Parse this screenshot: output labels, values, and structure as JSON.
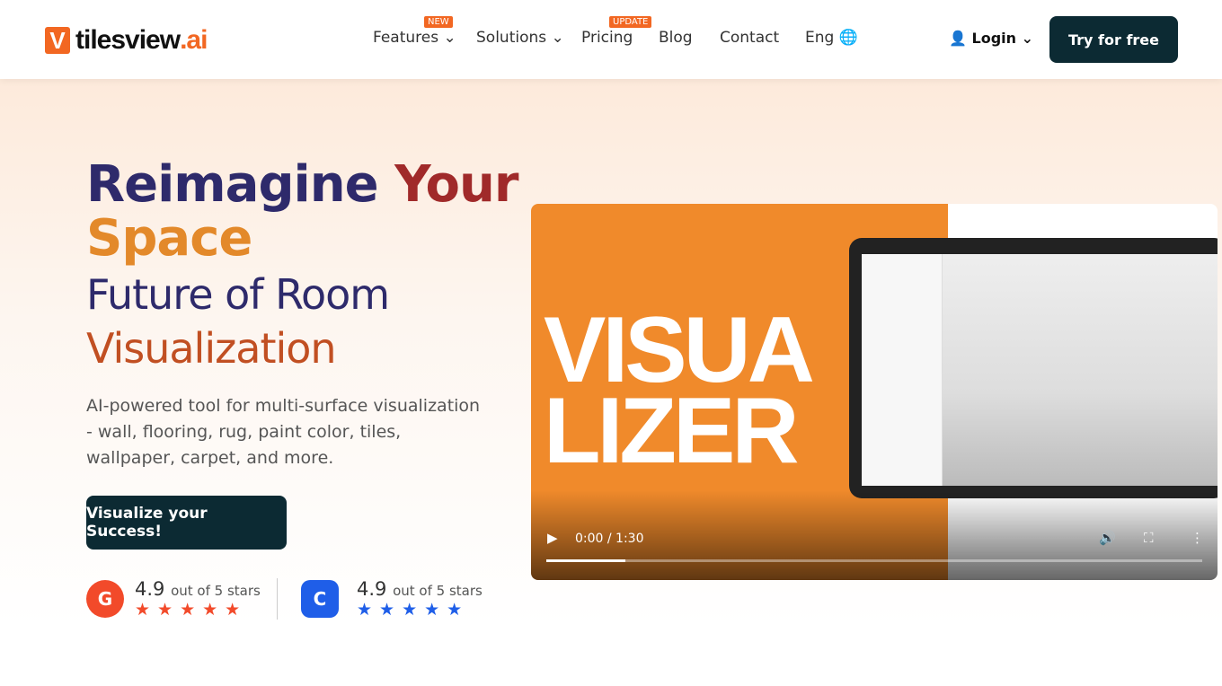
{
  "header": {
    "logo_mark": "V",
    "logo_text": "tilesview",
    "logo_suffix": ".ai",
    "nav": [
      {
        "label": "Features ⌄",
        "badge": "NEW"
      },
      {
        "label": "Solutions ⌄"
      },
      {
        "label": "Pricing",
        "badge": "UPDATE"
      },
      {
        "label": "Blog"
      },
      {
        "label": "Contact"
      },
      {
        "label": "Eng 🌐"
      }
    ],
    "login": "Login ⌄",
    "try": "Try for free"
  },
  "hero": {
    "title_a": "Reimagine",
    "title_b": "Your",
    "title_c": "Space",
    "sub_a": "Future of Room",
    "sub_b": "Visualization",
    "description": "AI-powered tool for multi-surface visualization - wall, flooring, rug, paint color, tiles, wallpaper, carpet, and more.",
    "cta": "Visualize your Success!"
  },
  "ratings": [
    {
      "source": "G2",
      "score": "4.9",
      "suffix": "out of 5 stars",
      "color": "#f24a2a"
    },
    {
      "source": "Capterra",
      "score": "4.9",
      "suffix": "out of 5 stars",
      "color": "#1f5ee8"
    }
  ],
  "video": {
    "text1": "VISUA",
    "text2": "LIZER",
    "time": "0:00 / 1:30",
    "progress": 0.12
  }
}
